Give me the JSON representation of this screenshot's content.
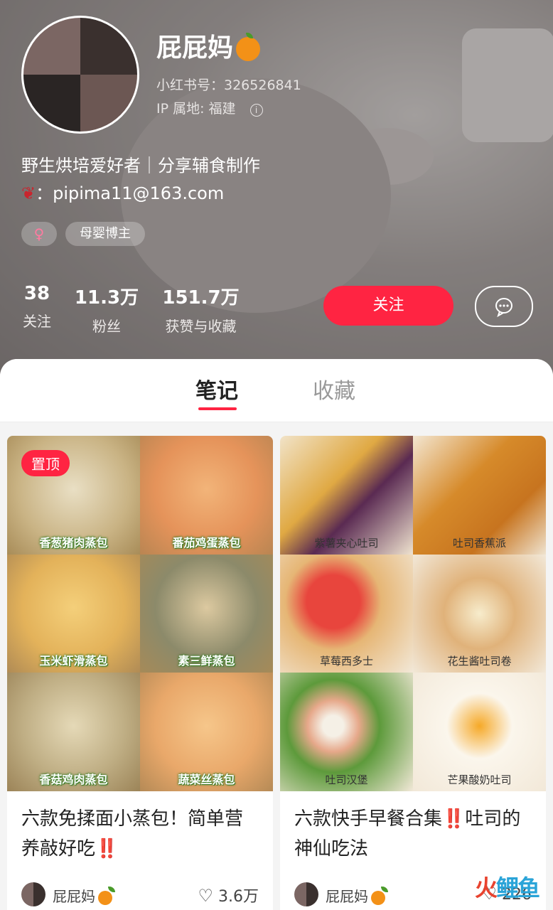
{
  "profile": {
    "name": "屁屁妈",
    "id_label": "小红书号：326526841",
    "ip_label": "IP 属地: 福建",
    "bio_line1": "野生烘培爱好者｜分享辅食制作",
    "bio_line2": "：pipima11@163.com",
    "gender_symbol": "♀",
    "tag": "母婴博主"
  },
  "stats": [
    {
      "num": "38",
      "label": "关注"
    },
    {
      "num": "11.3万",
      "label": "粉丝"
    },
    {
      "num": "151.7万",
      "label": "获赞与收藏"
    }
  ],
  "actions": {
    "follow": "关注"
  },
  "tabs": {
    "notes": "笔记",
    "collect": "收藏"
  },
  "notes": [
    {
      "pin": "置顶",
      "labels": [
        "香葱猪肉蒸包",
        "番茄鸡蛋蒸包",
        "玉米虾滑蒸包",
        "素三鲜蒸包",
        "香菇鸡肉蒸包",
        "蔬菜丝蒸包"
      ],
      "title": "六款免揉面小蒸包！简单营养敲好吃‼️",
      "author": "屁屁妈",
      "likes": "3.6万"
    },
    {
      "labels": [
        "紫薯夹心吐司",
        "吐司香蕉派",
        "草莓西多士",
        "花生酱吐司卷",
        "吐司汉堡",
        "芒果酸奶吐司"
      ],
      "title": "六款快手早餐合集‼️吐司的神仙吃法",
      "author": "屁屁妈",
      "likes": "226"
    }
  ],
  "watermark": "火鲤鱼",
  "colors": {
    "accent": "#ff2442",
    "orange": "#f39117"
  }
}
